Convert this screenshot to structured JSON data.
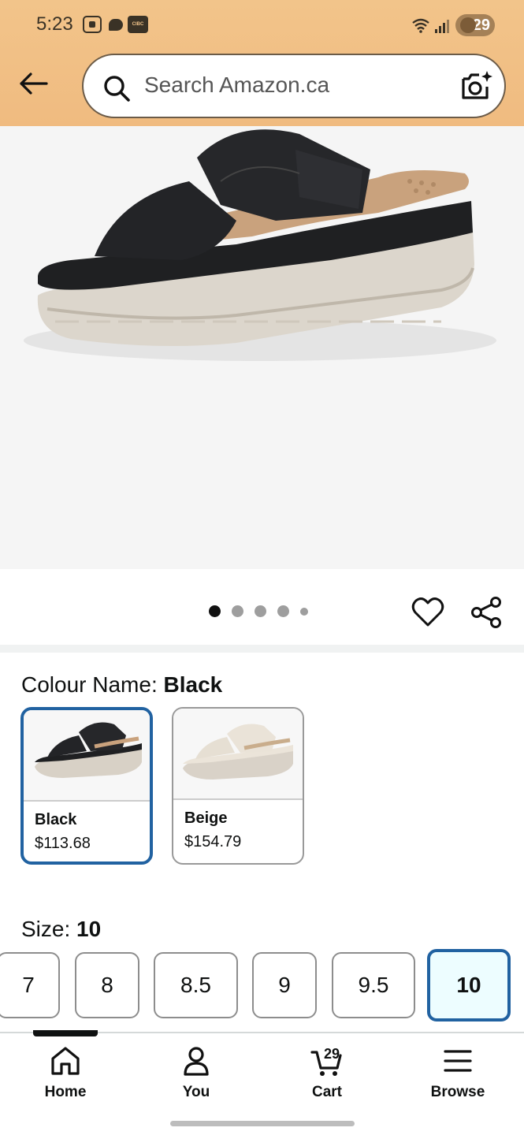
{
  "status_bar": {
    "time": "5:23",
    "notif_badge_text": "CIBC",
    "battery": "29"
  },
  "header": {
    "search": {
      "placeholder": "Search Amazon.ca"
    },
    "icons": [
      "back-arrow-icon",
      "search-icon",
      "camera-icon"
    ]
  },
  "gallery": {
    "image_count": 5,
    "active_index": 0
  },
  "colour": {
    "label": "Colour Name: ",
    "selected": "Black",
    "options": [
      {
        "name": "Black",
        "price": "$113.68"
      },
      {
        "name": "Beige",
        "price": "$154.79"
      }
    ]
  },
  "size": {
    "label": "Size: ",
    "selected": "10",
    "options": [
      "7",
      "8",
      "8.5",
      "9",
      "9.5",
      "10"
    ]
  },
  "nav": {
    "items": [
      {
        "label": "Home"
      },
      {
        "label": "You"
      },
      {
        "label": "Cart"
      },
      {
        "label": "Browse"
      }
    ],
    "cart_count": "29",
    "active": "Home"
  },
  "colors": {
    "header_bg": "#f2c48a",
    "accent_blue": "#2162a1",
    "selected_bg": "#edfdff"
  }
}
